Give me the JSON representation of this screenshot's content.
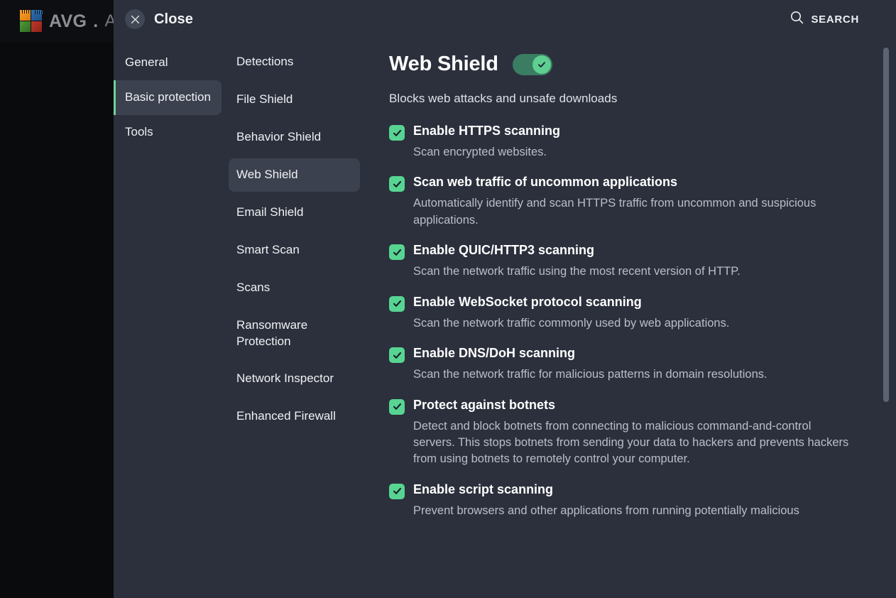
{
  "background_app": {
    "brand_name": "AVG",
    "brand_dot": ".",
    "product_name": "Ant",
    "logo_icon": "avg-pinwheel-logo"
  },
  "topbar": {
    "close_label": "Close",
    "close_icon": "close-x-icon",
    "search_label": "SEARCH",
    "search_icon": "search-icon"
  },
  "nav_primary": {
    "items": [
      {
        "label": "General",
        "active": false
      },
      {
        "label": "Basic protection",
        "active": true
      },
      {
        "label": "Tools",
        "active": false
      }
    ]
  },
  "nav_secondary": {
    "items": [
      {
        "label": "Detections",
        "active": false
      },
      {
        "label": "File Shield",
        "active": false
      },
      {
        "label": "Behavior Shield",
        "active": false
      },
      {
        "label": "Web Shield",
        "active": true
      },
      {
        "label": "Email Shield",
        "active": false
      },
      {
        "label": "Smart Scan",
        "active": false
      },
      {
        "label": "Scans",
        "active": false
      },
      {
        "label": "Ransomware Protection",
        "active": false
      },
      {
        "label": "Network Inspector",
        "active": false
      },
      {
        "label": "Enhanced Firewall",
        "active": false
      }
    ]
  },
  "panel": {
    "title": "Web Shield",
    "toggle_state": "on",
    "toggle_icon": "check-icon",
    "subtitle": "Blocks web attacks and unsafe downloads",
    "options": [
      {
        "label": "Enable HTTPS scanning",
        "description": "Scan encrypted websites.",
        "checked": true
      },
      {
        "label": "Scan web traffic of uncommon applications",
        "description": "Automatically identify and scan HTTPS traffic from uncommon and suspicious applications.",
        "checked": true
      },
      {
        "label": "Enable QUIC/HTTP3 scanning",
        "description": "Scan the network traffic using the most recent version of HTTP.",
        "checked": true
      },
      {
        "label": "Enable WebSocket protocol scanning",
        "description": "Scan the network traffic commonly used by web applications.",
        "checked": true
      },
      {
        "label": "Enable DNS/DoH scanning",
        "description": "Scan the network traffic for malicious patterns in domain resolutions.",
        "checked": true
      },
      {
        "label": "Protect against botnets",
        "description": "Detect and block botnets from connecting to malicious command-and-control servers. This stops botnets from sending your data to hackers and prevents hackers from using botnets to remotely control your computer.",
        "checked": true
      },
      {
        "label": "Enable script scanning",
        "description": "Prevent browsers and other applications from running potentially malicious",
        "checked": true
      }
    ]
  },
  "scrollbar": {
    "name": "content-scrollbar"
  },
  "colors": {
    "accent_green": "#6cd39a",
    "checkbox_green": "#57d492",
    "toggle_track": "#3a7d62",
    "modal_bg": "#2b303c",
    "nav_active_bg": "#3b414e",
    "app_bg": "#0a0b0d"
  }
}
